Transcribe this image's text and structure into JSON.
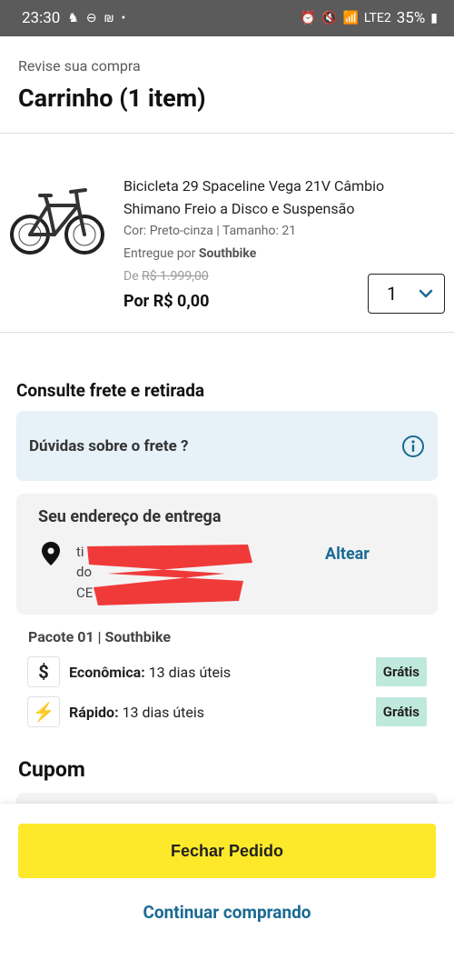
{
  "status_bar": {
    "time": "23:30",
    "battery": "35%",
    "network": "LTE2"
  },
  "header": {
    "subtitle": "Revise sua compra",
    "title": "Carrinho (1 item)"
  },
  "product": {
    "name": "Bicicleta 29 Spaceline Vega 21V Câmbio Shimano Freio a Disco e Suspensão",
    "attributes": "Cor: Preto-cinza   |   Tamanho: 21",
    "seller_prefix": "Entregue por ",
    "seller": "Southbike",
    "old_price_prefix": "De ",
    "old_price": "R$ 1.999,00",
    "price": "Por R$ 0,00",
    "quantity": "1"
  },
  "shipping": {
    "section_title": "Consulte frete e retirada",
    "faq": "Dúvidas sobre o frete ?",
    "address_label": "Seu endereço de entrega",
    "address_line1": "ti",
    "address_line2": "do",
    "address_line3": "CE",
    "edit_label": "Altear",
    "package": "Pacote 01 | Southbike",
    "options": [
      {
        "icon": "$",
        "name": "Econômica:",
        "time": " 13 dias úteis",
        "price": "Grátis"
      },
      {
        "icon": "⚡",
        "name": "Rápido:",
        "time": " 13 dias úteis",
        "price": "Grátis"
      }
    ]
  },
  "coupon": {
    "title": "Cupom"
  },
  "actions": {
    "checkout": "Fechar Pedido",
    "continue": "Continuar comprando"
  },
  "colors": {
    "accent": "#1a6a93",
    "checkout_bg": "#fde92a",
    "badge_bg": "#bfe9dd",
    "faq_bg": "#e6f1f8"
  }
}
